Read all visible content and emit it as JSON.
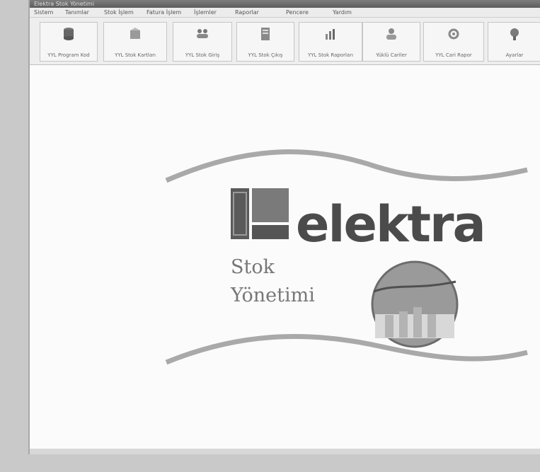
{
  "window": {
    "title": "Elektra Stok Yönetimi"
  },
  "menu": [
    "Sistem",
    "Tanımlar",
    "Stok İşlem",
    "Fatura İşlem",
    "İşlemler",
    "Raporlar",
    "Pencere",
    "Yardım"
  ],
  "toolbar": [
    {
      "label": "YYL Program Kod",
      "icon": "database-icon"
    },
    {
      "label": "YYL Stok Kartları",
      "icon": "box-icon"
    },
    {
      "label": "YYL Stok Giriş",
      "icon": "people-icon"
    },
    {
      "label": "YYL Stok Çıkış",
      "icon": "document-icon"
    },
    {
      "label": "YYL Stok Raporları",
      "icon": "chart-icon"
    },
    {
      "label": "Yüklü Cariler",
      "icon": "people-icon"
    },
    {
      "label": "YYL Cari Rapor",
      "icon": "gear-icon"
    },
    {
      "label": "Ayarlar",
      "icon": "settings-icon"
    }
  ],
  "logo": {
    "brand": "elektra",
    "line1": "Stok",
    "line2": "Yönetimi"
  },
  "colors": {
    "titlebar": "#6b6b6b",
    "window": "#f3f3f3",
    "content": "#fbfbfb",
    "logo_text": "#4b4b4b"
  }
}
